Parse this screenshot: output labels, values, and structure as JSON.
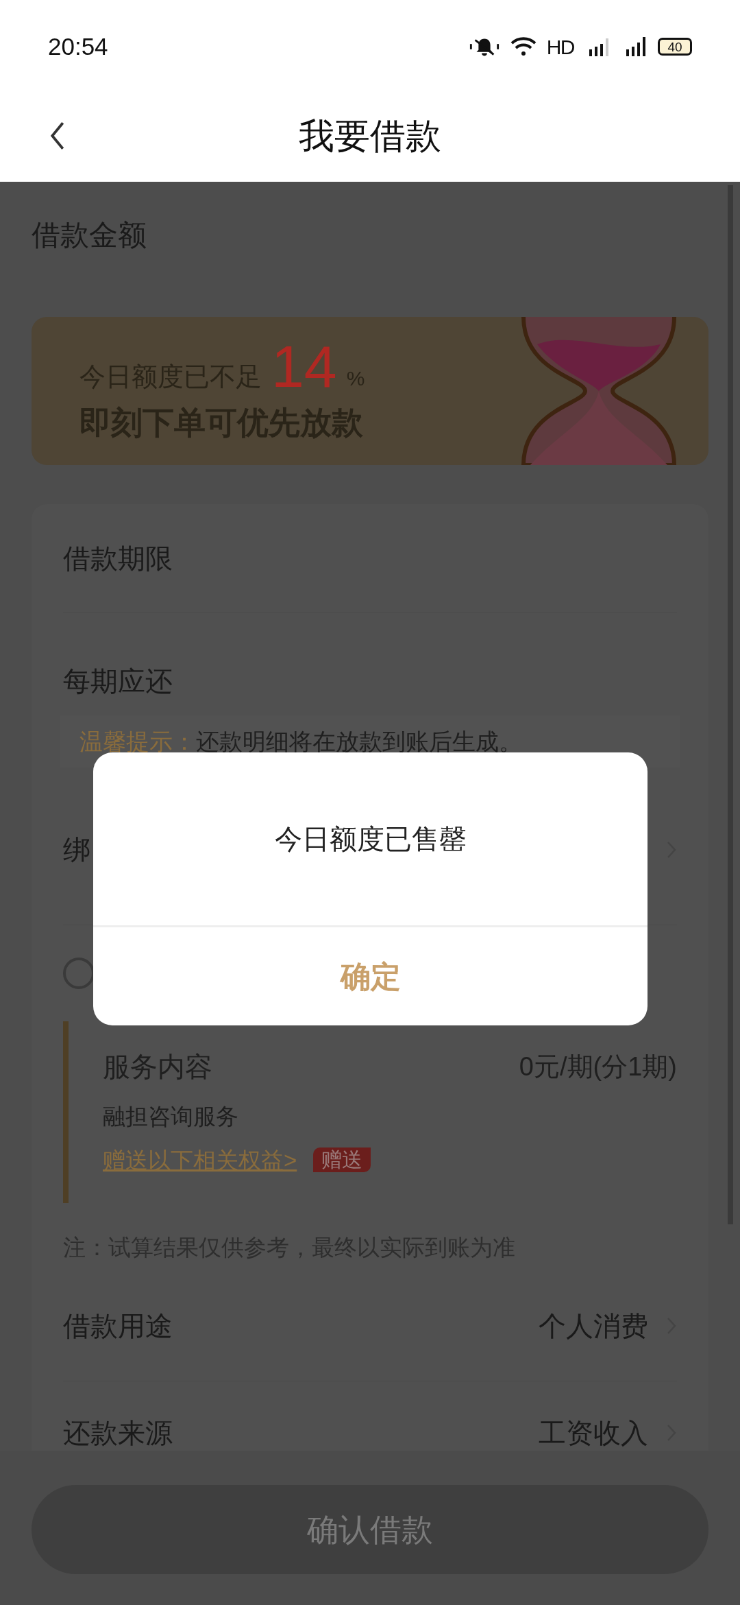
{
  "status_bar": {
    "time": "20:54",
    "network": "HD",
    "battery": "40"
  },
  "header": {
    "title": "我要借款"
  },
  "amount_section": {
    "label": "借款金额"
  },
  "banner": {
    "line1": "今日额度已不足",
    "percent": "14",
    "percent_unit": "%",
    "line2": "即刻下单可优先放款"
  },
  "loan_term": {
    "label": "借款期限"
  },
  "installment": {
    "label": "每期应还"
  },
  "tip": {
    "label": "温馨提示：",
    "text": "还款明细将在放款到账后生成。"
  },
  "bind_row": {
    "label": "绑"
  },
  "agreement": {
    "checked": false
  },
  "service": {
    "title": "服务内容",
    "price": "0元/期(分1期)",
    "name": "融担咨询服务",
    "link": "赠送以下相关权益>",
    "badge": "赠送"
  },
  "note": "注：试算结果仅供参考，最终以实际到账为准",
  "selects": [
    {
      "label": "借款用途",
      "value": "个人消费"
    },
    {
      "label": "还款来源",
      "value": "工资收入"
    }
  ],
  "confirm_button": {
    "label": "确认借款",
    "disabled": true
  },
  "dialog": {
    "message": "今日额度已售罄",
    "ok": "确定"
  }
}
